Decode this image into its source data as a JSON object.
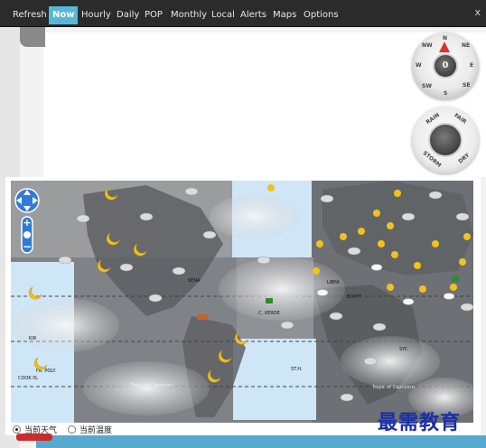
{
  "menu": {
    "items": [
      "Refresh",
      "Now",
      "Hourly",
      "Daily",
      "POP",
      "Monthly",
      "Local",
      "Alerts",
      "Maps",
      "Options"
    ],
    "active": "Now",
    "close": "x"
  },
  "compass": {
    "labels": {
      "n": "N",
      "ne": "NE",
      "e": "E",
      "se": "SE",
      "s": "S",
      "sw": "SW",
      "w": "W",
      "nw": "NW"
    },
    "value": "0"
  },
  "barometer": {
    "labels": {
      "rain": "RAIN",
      "fair": "FAIR",
      "dry": "DRY",
      "storm": "STORM"
    }
  },
  "map": {
    "labels": [
      "Tropic of Cancer",
      "Tropic of Capricorn",
      "SENA",
      "C. VERDE",
      "EGYPT",
      "LIBYA",
      "SYC",
      "ST.H.",
      "FR. POLY.",
      "COOK IS.",
      "KIR",
      "ALG"
    ],
    "radios": [
      {
        "label": "当前天气",
        "checked": true
      },
      {
        "label": "当前温度",
        "checked": false
      }
    ]
  },
  "watermark": "最需教育",
  "colors": {
    "menubar": "#2b2b2b",
    "active_tab": "#58b7d6",
    "map_ocean": "#cfe6f7",
    "map_land": "#7f8286",
    "sun": "#f2c21b"
  }
}
